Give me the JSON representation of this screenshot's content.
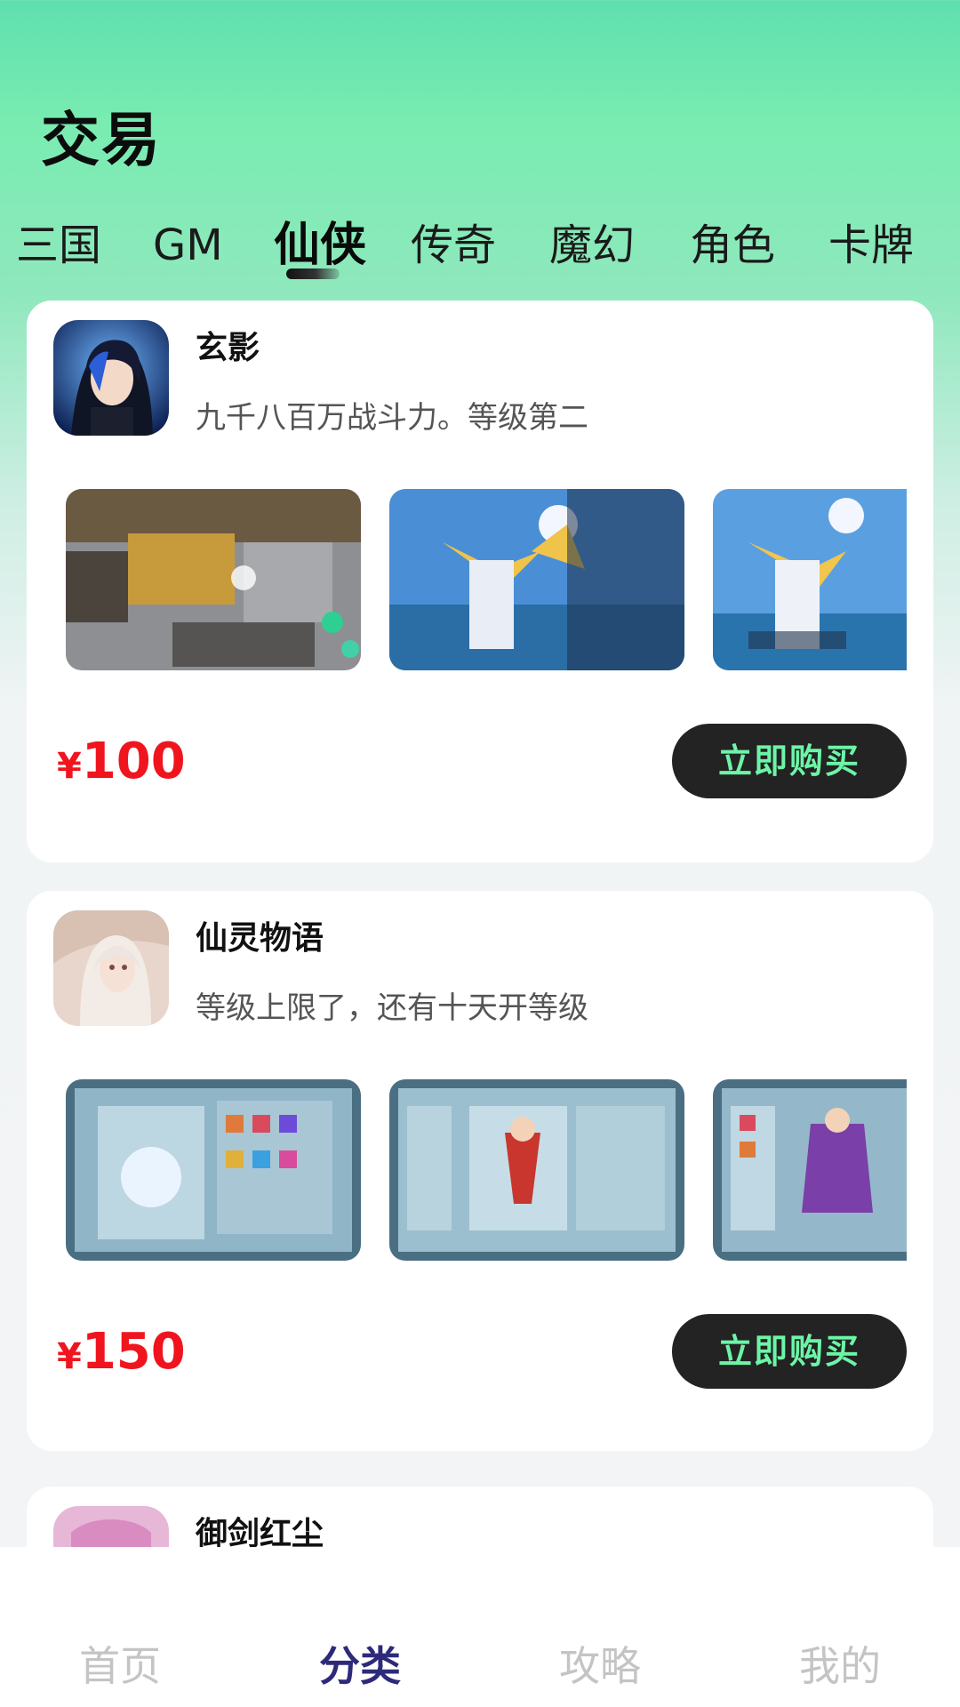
{
  "header": {
    "title": "交易"
  },
  "tabs": [
    {
      "label": "三国"
    },
    {
      "label": "GM"
    },
    {
      "label": "仙侠"
    },
    {
      "label": "传奇"
    },
    {
      "label": "魔幻"
    },
    {
      "label": "角色"
    },
    {
      "label": "卡牌"
    }
  ],
  "active_tab": "仙侠",
  "listings": [
    {
      "name": "玄影",
      "description": "九千八百万战斗力。等级第二",
      "currency": "¥",
      "price": "100",
      "buy_label": "立即购买"
    },
    {
      "name": "仙灵物语",
      "description": "等级上限了，还有十天开等级",
      "currency": "¥",
      "price": "150",
      "buy_label": "立即购买"
    },
    {
      "name": "御剑红尘"
    }
  ],
  "bottom_nav": [
    {
      "label": "首页"
    },
    {
      "label": "分类"
    },
    {
      "label": "攻略"
    },
    {
      "label": "我的"
    }
  ],
  "active_nav": "分类",
  "colors": {
    "accent_green": "#6cf5a7",
    "price_red": "#f0141e",
    "button_dark": "#232323",
    "nav_active": "#2e2a7a",
    "nav_inactive": "#c4c4c4"
  }
}
